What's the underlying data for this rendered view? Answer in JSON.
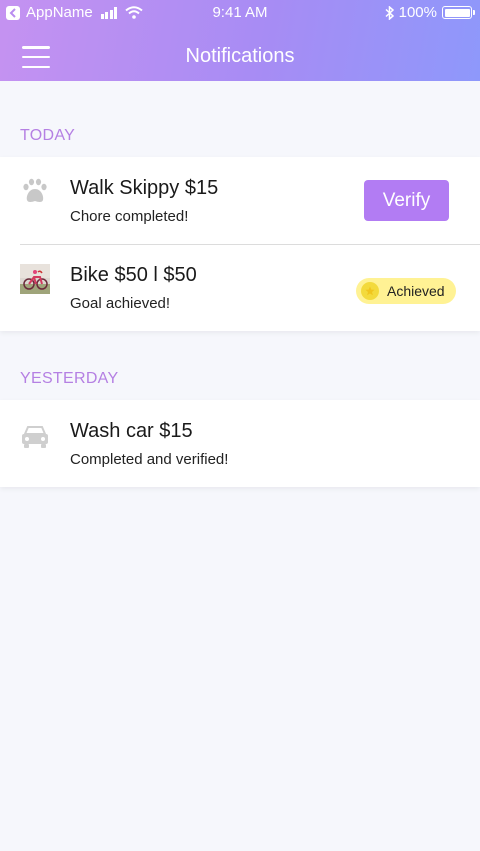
{
  "status_bar": {
    "app_name": "AppName",
    "time": "9:41 AM",
    "battery": "100%"
  },
  "header": {
    "title": "Notifications"
  },
  "sections": [
    {
      "label": "TODAY",
      "items": [
        {
          "icon": "paw-icon",
          "title": "Walk Skippy $15",
          "subtitle": "Chore completed!",
          "action": "Verify"
        },
        {
          "icon": "bike-photo",
          "title": "Bike $50 l $50",
          "subtitle": "Goal achieved!",
          "badge": "Achieved"
        }
      ]
    },
    {
      "label": "YESTERDAY",
      "items": [
        {
          "icon": "car-icon",
          "title": "Wash car $15",
          "subtitle": "Completed and verified!"
        }
      ]
    }
  ],
  "colors": {
    "accent": "#b27cf3",
    "section_label": "#b580e3",
    "badge_bg": "#fff294"
  }
}
